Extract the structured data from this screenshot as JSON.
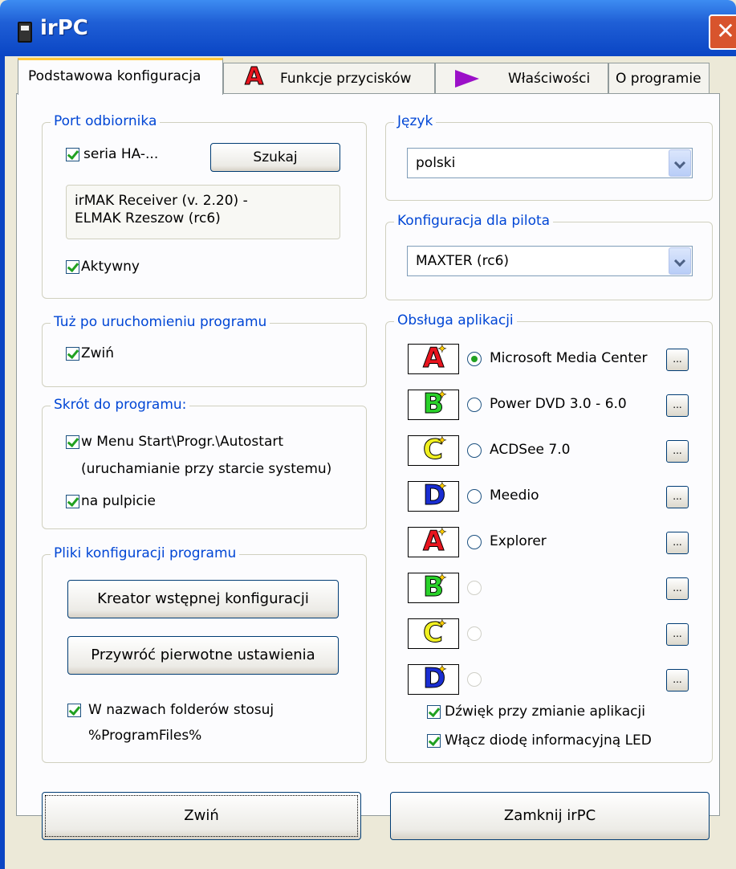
{
  "window": {
    "title": "irPC",
    "close_icon": "close-icon"
  },
  "tabs": [
    {
      "label": "Podstawowa konfiguracja",
      "active": true
    },
    {
      "label": "Funkcje przycisków",
      "icon": "letter-a-icon"
    },
    {
      "label": "Właściwości",
      "icon": "play-arrow-icon"
    },
    {
      "label": "O programie"
    }
  ],
  "port": {
    "label": "Port odbiornika",
    "series_label": "seria HA-...",
    "search_button": "Szukaj",
    "receiver_line1": "irMAK Receiver   (v. 2.20)  -",
    "receiver_line2": "ELMAK Rzeszow      (rc6)",
    "active_label": "Aktywny"
  },
  "startup": {
    "label": "Tuż po uruchomieniu programu",
    "collapse_label": "Zwiń"
  },
  "shortcut": {
    "label": "Skrót do programu:",
    "menu_label": "w Menu Start\\Progr.\\Autostart",
    "menu_note": "(uruchamianie przy starcie systemu)",
    "desktop_label": "na pulpicie"
  },
  "config_files": {
    "label": "Pliki konfiguracji programu",
    "wizard_button": "Kreator wstępnej konfiguracji",
    "restore_button": "Przywróć pierwotne ustawienia",
    "folder_label1": "W nazwach folderów stosuj",
    "folder_label2": "%ProgramFiles%"
  },
  "language": {
    "label": "Język",
    "value": "polski"
  },
  "remote": {
    "label": "Konfiguracja dla pilota",
    "value": "MAXTER (rc6)"
  },
  "apps": {
    "label": "Obsługa aplikacji",
    "items": [
      {
        "letter": "A",
        "color": "#e8141e",
        "name": "Microsoft Media Center",
        "selected": true
      },
      {
        "letter": "B",
        "color": "#2ad22a",
        "name": "Power DVD 3.0 - 6.0"
      },
      {
        "letter": "C",
        "color": "#f0f020",
        "name": "ACDSee 7.0"
      },
      {
        "letter": "D",
        "color": "#1a2ed2",
        "name": "Meedio"
      },
      {
        "letter": "A",
        "color": "#e8141e",
        "name": "Explorer"
      },
      {
        "letter": "B",
        "color": "#2ad22a",
        "name": ""
      },
      {
        "letter": "C",
        "color": "#f0f020",
        "name": ""
      },
      {
        "letter": "D",
        "color": "#1a2ed2",
        "name": ""
      }
    ],
    "more_button": "...",
    "sound_label": "Dźwięk przy zmianie aplikacji",
    "led_label": "Włącz diodę informacyjną LED"
  },
  "footer": {
    "collapse_button": "Zwiń",
    "close_button": "Zamknij irPC"
  }
}
